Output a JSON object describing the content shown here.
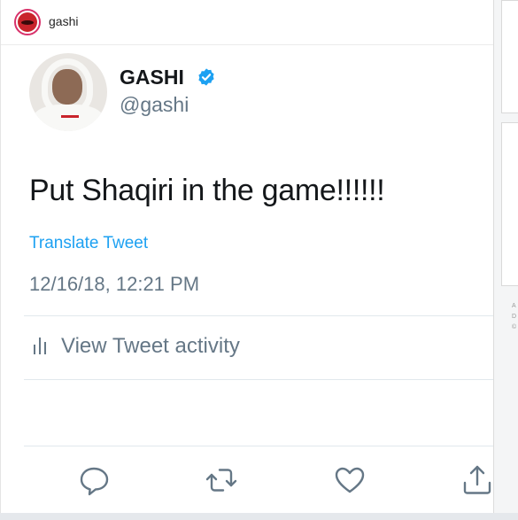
{
  "instagram_post": {
    "username": "gashi"
  },
  "tweet": {
    "display_name": "GASHI",
    "handle": "@gashi",
    "text": "Put Shaqiri in the game!!!!!!",
    "translate_label": "Translate Tweet",
    "timestamp": "12/16/18, 12:21 PM",
    "activity_label": "View Tweet activity",
    "verified_color": "#1da1f2",
    "icons": [
      "reply-icon",
      "retweet-icon",
      "like-icon",
      "share-icon",
      "bar-chart-icon",
      "verified-badge-icon"
    ]
  },
  "side_panel": {
    "letters": [
      "A",
      "D",
      "©"
    ]
  },
  "colors": {
    "link": "#1da1f2",
    "muted": "#657786",
    "text": "#14171a",
    "icon": "#657786"
  }
}
